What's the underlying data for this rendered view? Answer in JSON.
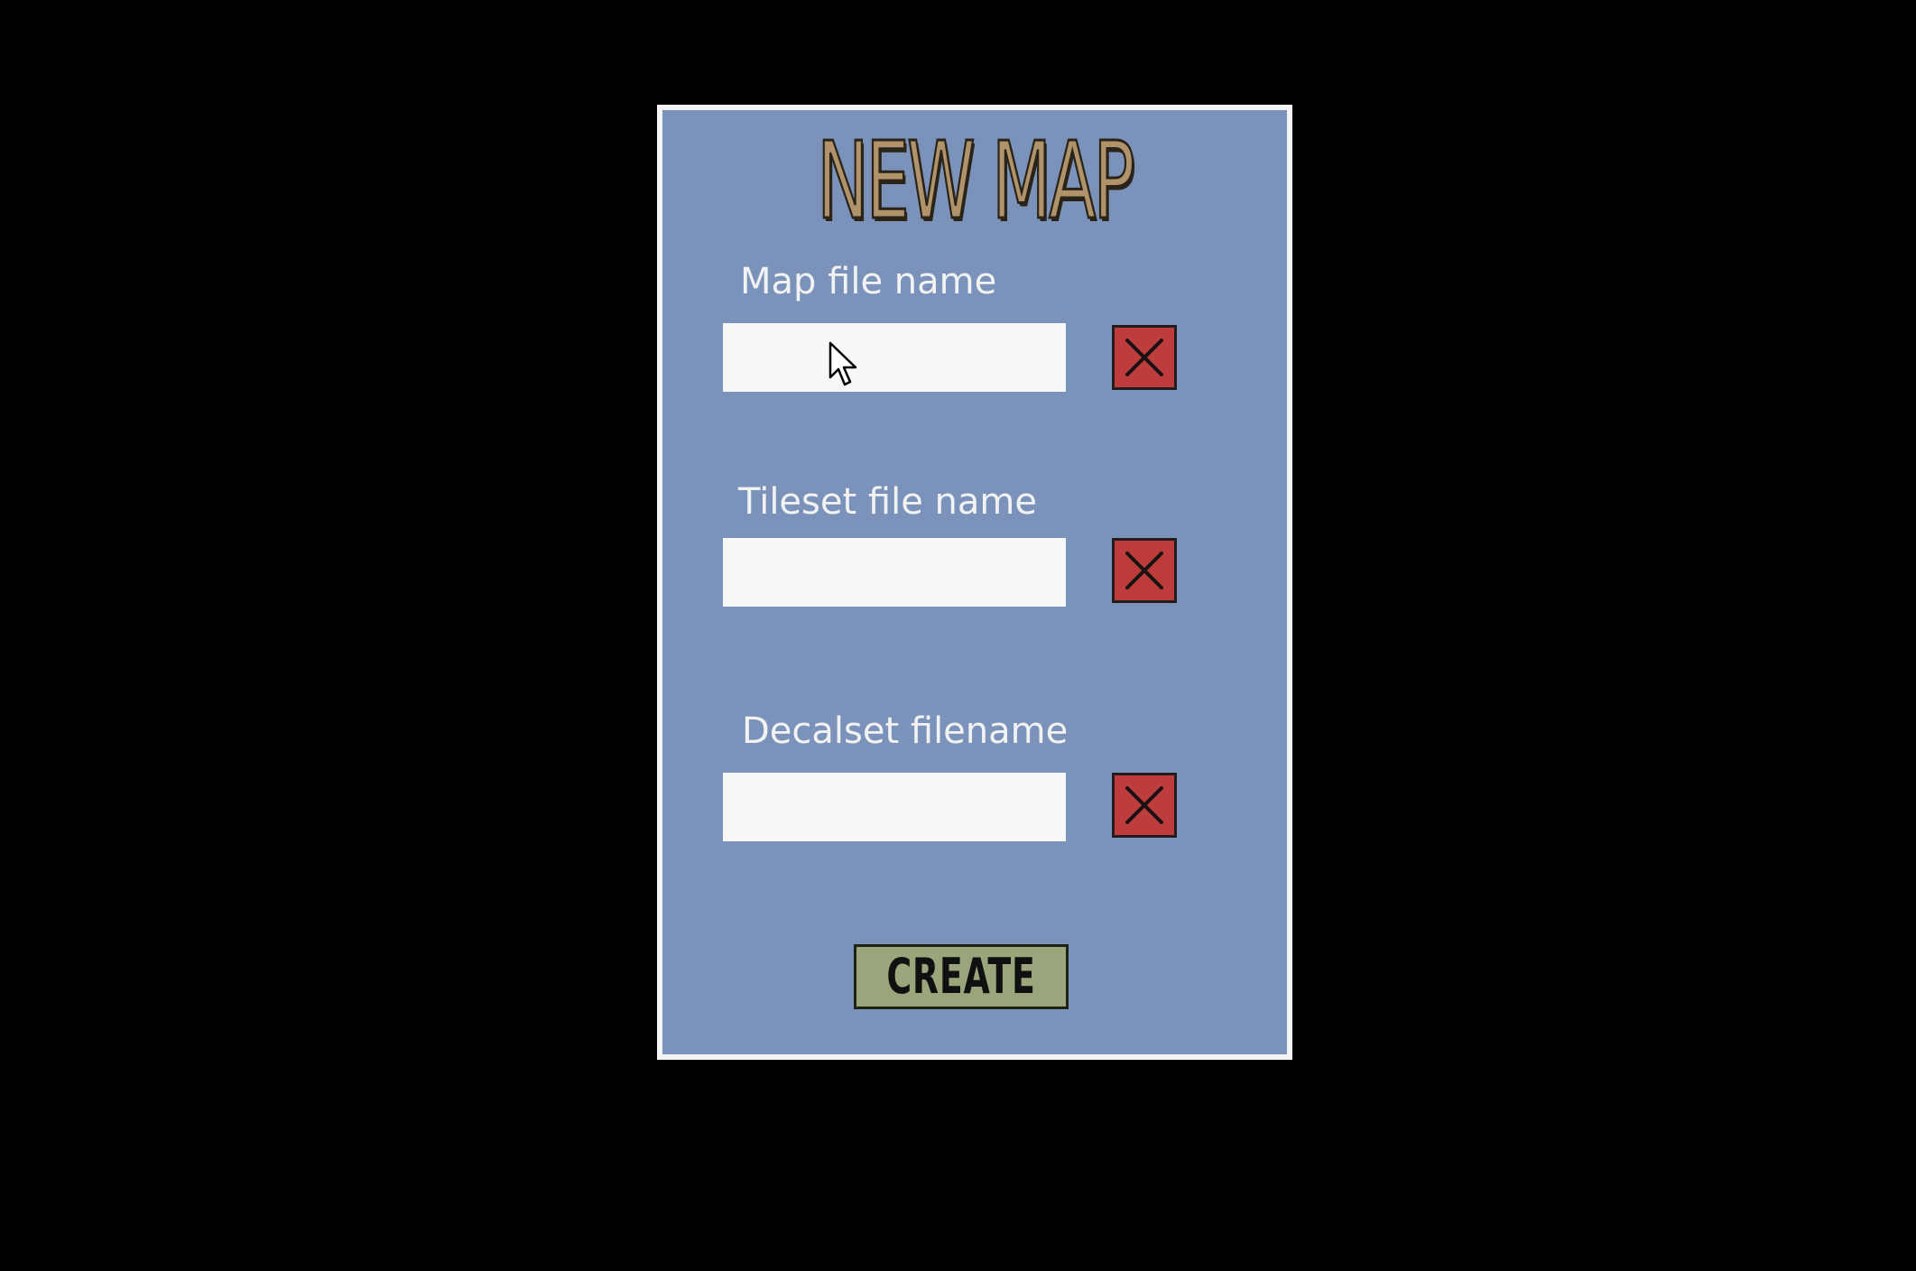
{
  "dialog": {
    "title": "NEW MAP",
    "fields": [
      {
        "label": "Map file name",
        "value": "",
        "placeholder": ""
      },
      {
        "label": "Tileset file name",
        "value": "",
        "placeholder": ""
      },
      {
        "label": "Decalset filename",
        "value": "",
        "placeholder": ""
      }
    ],
    "create_label": "CREATE"
  },
  "icons": {
    "clear": "close-icon",
    "cursor": "mouse-pointer-icon"
  },
  "colors": {
    "background": "#000000",
    "panel": "#7b93bb",
    "panel_border": "#f4f4f4",
    "title": "#b0936a",
    "clear_button": "#bf3c3c",
    "create_button": "#9aa57c",
    "input": "#f7f7f7"
  }
}
